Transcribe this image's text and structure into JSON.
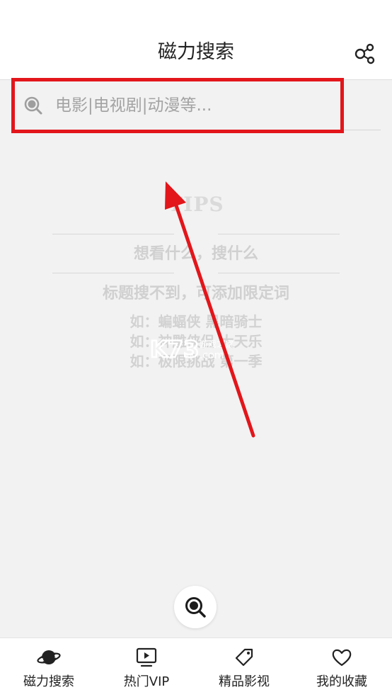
{
  "header": {
    "title": "磁力搜索",
    "share_icon": "share-icon"
  },
  "search": {
    "placeholder": "电影|电视剧|动漫等...",
    "icon": "search-icon"
  },
  "tips": {
    "title": "TIPS",
    "main": "想看什么，搜什么",
    "hint": "标题搜不到，可添加限定词",
    "examples": [
      "如：蝙蝠侠 黑暗骑士",
      "如：神雕侠侣 大天乐",
      "如：极限挑战 第一季"
    ]
  },
  "watermark": {
    "brand": "K73",
    "sub": "游戏之家",
    "domain": ".com"
  },
  "fab": {
    "icon": "search-icon"
  },
  "tabbar": {
    "items": [
      {
        "label": "磁力搜索",
        "icon": "planet-icon",
        "active": true
      },
      {
        "label": "热门VIP",
        "icon": "tv-play-icon",
        "active": false
      },
      {
        "label": "精品影视",
        "icon": "tag-icon",
        "active": false
      },
      {
        "label": "我的收藏",
        "icon": "heart-icon",
        "active": false
      }
    ]
  },
  "colors": {
    "highlight": "#e2161b",
    "background": "#f2f2f2",
    "tips_text": "#d0d0d0"
  }
}
